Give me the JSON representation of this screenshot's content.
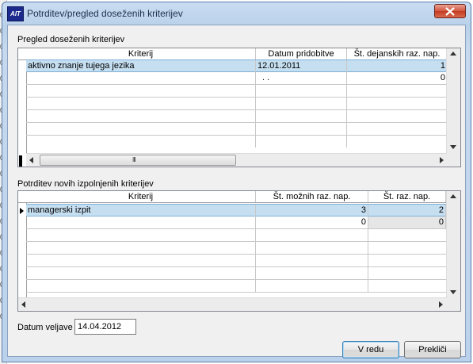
{
  "background_rows": [
    "0",
    "0",
    "0",
    "0",
    "0",
    "0",
    "0",
    "0",
    "0",
    "0",
    "0",
    "0",
    "0",
    "0",
    "0",
    "0",
    "0",
    "0",
    "0",
    "0"
  ],
  "window": {
    "title": "Potrditev/pregled doseženih kriterijev",
    "icon_text": "AIT"
  },
  "section1": {
    "label": "Pregled doseženih kriterijev",
    "columns": [
      "Kriterij",
      "Datum pridobitve",
      "Št. dejanskih raz. nap."
    ],
    "rows": [
      {
        "kriterij": "aktivno znanje tujega jezika",
        "datum": "12.01.2011",
        "st": "1"
      },
      {
        "kriterij": "",
        "datum": " .  .",
        "st": "0"
      }
    ],
    "hscroll_grip": "III"
  },
  "section2": {
    "label": "Potrditev novih izpolnjenih kriterijev",
    "columns": [
      "Kriterij",
      "Št. možnih raz. nap.",
      "Št. raz. nap."
    ],
    "rows": [
      {
        "kriterij": "managerski izpit",
        "mozne": "3",
        "raz": "2"
      },
      {
        "kriterij": "",
        "mozne": "0",
        "raz": "0"
      }
    ]
  },
  "footer": {
    "date_label": "Datum veljave",
    "date_value": "14.04.2012",
    "ok_label": "V redu",
    "cancel_label": "Prekliči"
  },
  "colors": {
    "selection": "#c5dff1",
    "title_bar": "#bcd2ec",
    "close_button": "#c23b22"
  }
}
